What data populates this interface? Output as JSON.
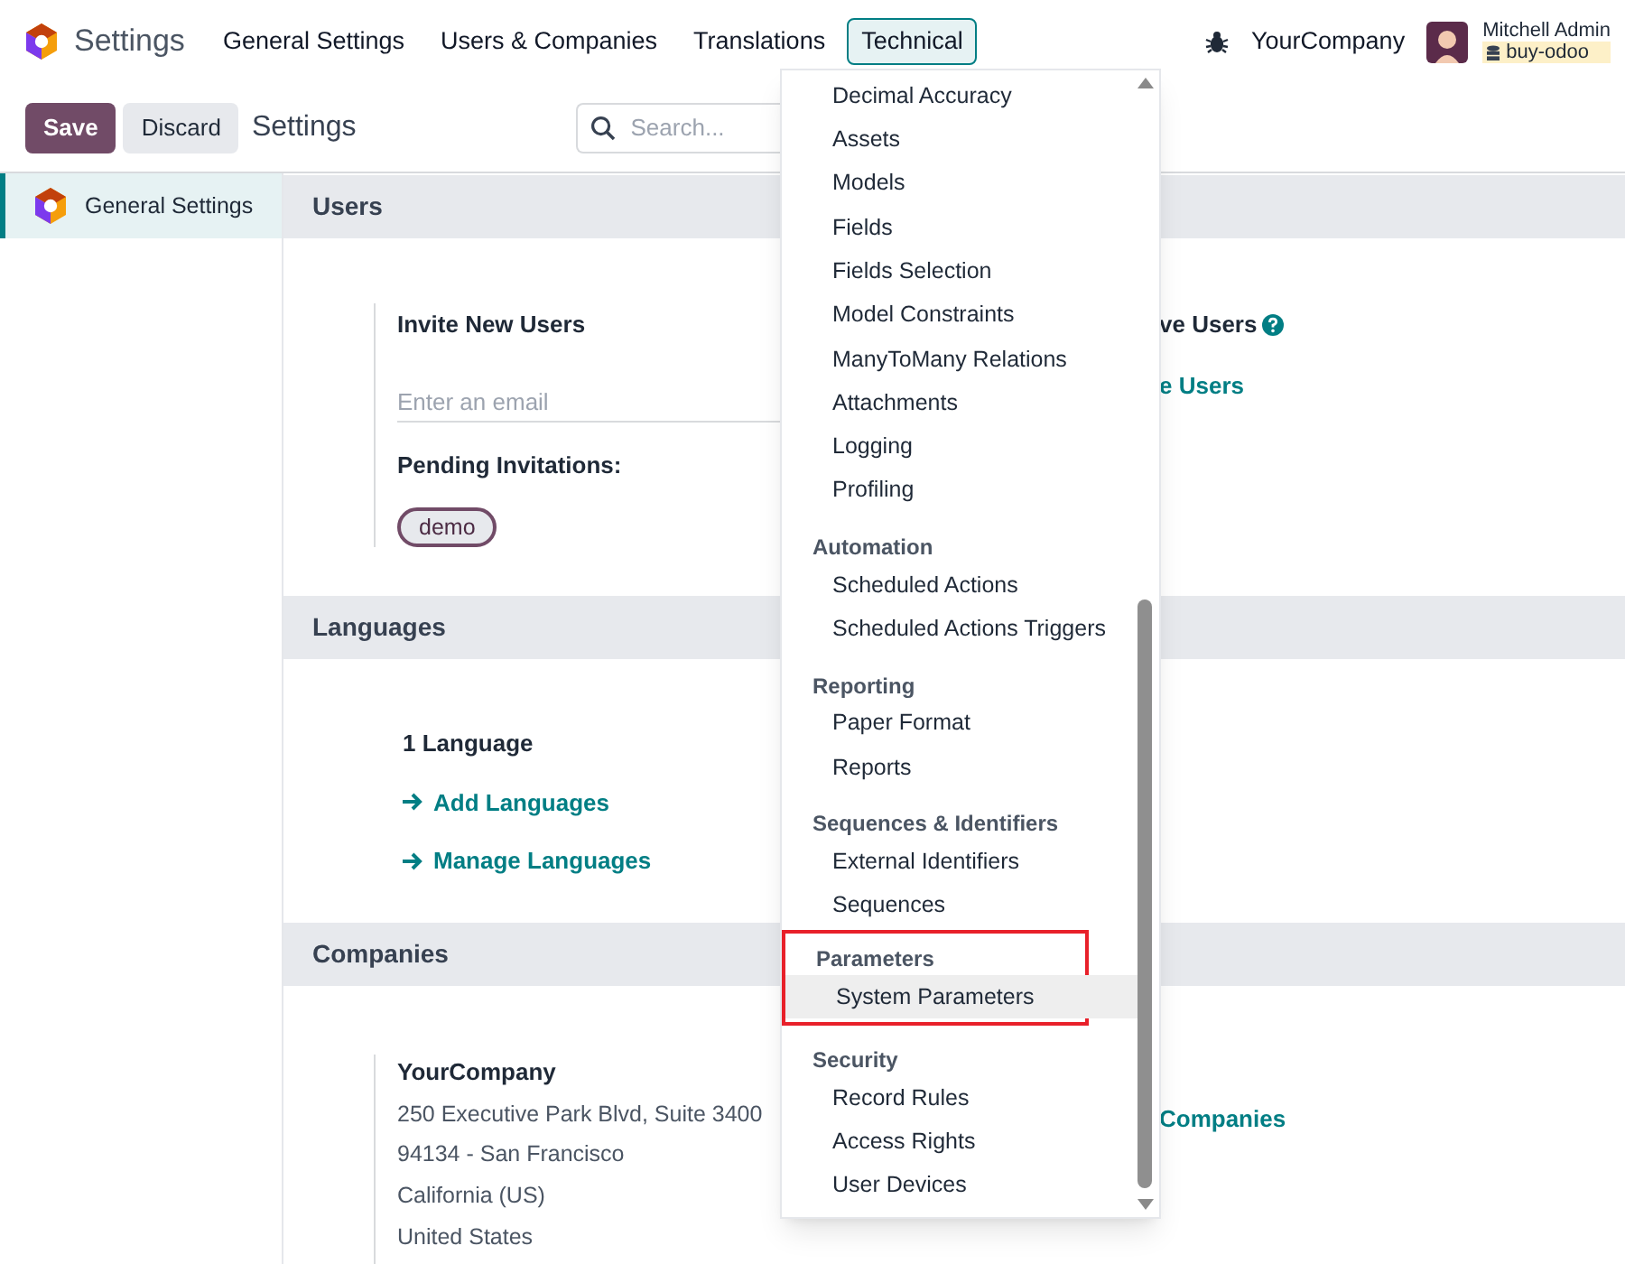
{
  "app_title": "Settings",
  "nav_tabs": [
    {
      "label": "General Settings",
      "selected": false
    },
    {
      "label": "Users & Companies",
      "selected": false
    },
    {
      "label": "Translations",
      "selected": false
    },
    {
      "label": "Technical",
      "selected": true
    }
  ],
  "company": "YourCompany",
  "user": {
    "name": "Mitchell Admin",
    "database": "buy-odoo"
  },
  "toolbar": {
    "save": "Save",
    "discard": "Discard",
    "title": "Settings",
    "search_placeholder": "Search..."
  },
  "sidebar": {
    "items": [
      {
        "label": "General Settings",
        "selected": true
      }
    ]
  },
  "users": {
    "heading": "Users",
    "invite_label": "Invite New Users",
    "email_placeholder": "Enter an email",
    "pending_label": "Pending Invitations:",
    "pending_tags": [
      "demo"
    ],
    "right_label": "ve Users",
    "right_link": "e Users"
  },
  "languages": {
    "heading": "Languages",
    "count": "1 Language",
    "links": [
      "Add Languages",
      "Manage Languages"
    ]
  },
  "companies": {
    "heading": "Companies",
    "name": "YourCompany",
    "address": [
      "250 Executive Park Blvd, Suite 3400",
      "94134 - San Francisco",
      "California (US)",
      "United States"
    ],
    "right_link": "Companies"
  },
  "technical_menu": {
    "groups": [
      {
        "items": [
          {
            "label": "Decimal Accuracy",
            "selected": false
          },
          {
            "label": "Assets",
            "selected": false
          },
          {
            "label": "Models",
            "selected": false
          },
          {
            "label": "Fields",
            "selected": false
          },
          {
            "label": "Fields Selection",
            "selected": false
          },
          {
            "label": "Model Constraints",
            "selected": false
          },
          {
            "label": "ManyToMany Relations",
            "selected": false
          },
          {
            "label": "Attachments",
            "selected": false
          },
          {
            "label": "Logging",
            "selected": false
          },
          {
            "label": "Profiling",
            "selected": false
          }
        ]
      },
      {
        "heading": "Automation",
        "items": [
          {
            "label": "Scheduled Actions",
            "selected": false
          },
          {
            "label": "Scheduled Actions Triggers",
            "selected": false
          }
        ]
      },
      {
        "heading": "Reporting",
        "items": [
          {
            "label": "Paper Format",
            "selected": false
          },
          {
            "label": "Reports",
            "selected": false
          }
        ]
      },
      {
        "heading": "Sequences & Identifiers",
        "items": [
          {
            "label": "External Identifiers",
            "selected": false
          },
          {
            "label": "Sequences",
            "selected": false
          }
        ]
      },
      {
        "heading": "Parameters",
        "highlighted": true,
        "items": [
          {
            "label": "System Parameters",
            "selected": true
          }
        ]
      },
      {
        "heading": "Security",
        "items": [
          {
            "label": "Record Rules",
            "selected": false
          },
          {
            "label": "Access Rights",
            "selected": false
          },
          {
            "label": "User Devices",
            "selected": false
          }
        ]
      }
    ]
  }
}
